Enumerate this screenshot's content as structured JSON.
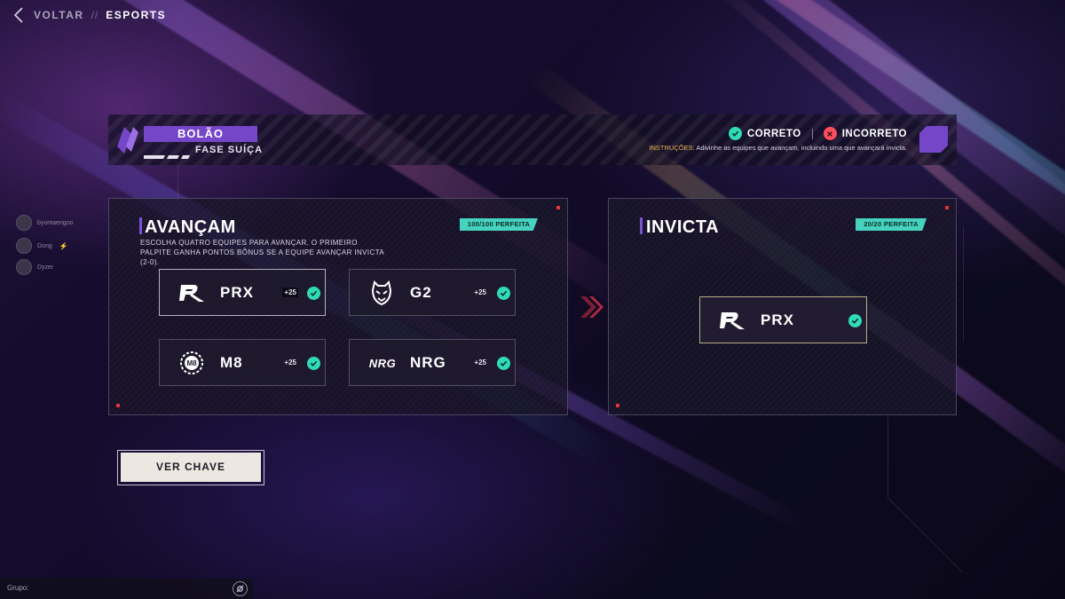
{
  "nav": {
    "back_label": "VOLTAR",
    "separator": "//",
    "current": "ESPORTS"
  },
  "banner": {
    "title": "BOLÃO",
    "subtitle": "FASE SUÍÇA",
    "legend_correct": "CORRETO",
    "legend_incorrect": "INCORRETO",
    "instructions_label": "INSTRUÇÕES:",
    "instructions_text": "Adivinhe as equipes que avançam, incluindo uma que avançará invicta."
  },
  "advance_panel": {
    "title": "AVANÇAM",
    "score_badge": "100/100 PERFEITA",
    "description": "ESCOLHA QUATRO EQUIPES PARA AVANÇAR. O PRIMEIRO PALPITE GANHA PONTOS BÔNUS SE A EQUIPE AVANÇAR INVICTA (2-0).",
    "teams": [
      {
        "name": "PRX",
        "bonus": "+25",
        "status": "correct",
        "logo_icon": "prx-logo-icon"
      },
      {
        "name": "G2",
        "bonus": "+25",
        "status": "correct",
        "logo_icon": "g2-logo-icon"
      },
      {
        "name": "M8",
        "bonus": "+25",
        "status": "correct",
        "logo_icon": "m8-logo-icon"
      },
      {
        "name": "NRG",
        "bonus": "+25",
        "status": "correct",
        "logo_icon": "nrg-logo-icon",
        "logo_text": "NRG"
      }
    ]
  },
  "undefeated_panel": {
    "title": "INVICTA",
    "score_badge": "20/20 PERFEITA",
    "team": {
      "name": "PRX",
      "status": "correct",
      "logo_icon": "prx-logo-icon"
    }
  },
  "view_bracket_button": "VER CHAVE",
  "friends": [
    {
      "name": "byuntaengoo"
    },
    {
      "name": "Dong"
    },
    {
      "name": "Dyzer"
    }
  ],
  "chat": {
    "label": "Grupo:"
  },
  "colors": {
    "accent_purple": "#7646c9",
    "correct_teal": "#2fdcb5",
    "incorrect_red": "#ff4f5e",
    "badge_teal": "#46d2be",
    "corner_red": "#e3343d",
    "button_bg": "#ece8e1"
  }
}
